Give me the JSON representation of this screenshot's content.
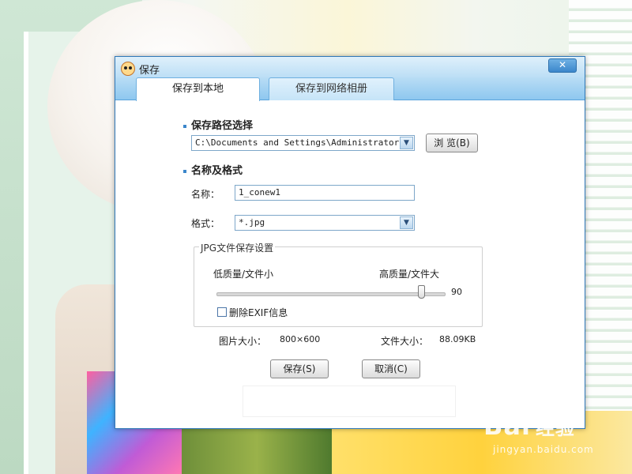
{
  "dialog": {
    "title": "保存",
    "close_label": "✕",
    "tabs": [
      {
        "label": "保存到本地",
        "active": true
      },
      {
        "label": "保存到网络相册",
        "active": false
      }
    ],
    "path_section": {
      "title": "保存路径选择",
      "path_value": "C:\\Documents and Settings\\Administrator\\…",
      "browse_label": "浏 览(B)"
    },
    "name_section": {
      "title": "名称及格式",
      "name_label": "名称：",
      "name_value": "1_conew1",
      "format_label": "格式：",
      "format_value": "*.jpg"
    },
    "jpg_settings": {
      "legend": "JPG文件保存设置",
      "low_label": "低质量/文件小",
      "high_label": "高质量/文件大",
      "quality_value": "90",
      "quality_fraction": 0.9,
      "exif_label": "删除EXIF信息",
      "exif_checked": false
    },
    "info": {
      "image_size_label": "图片大小：",
      "image_size_value": "800×600",
      "file_size_label": "文件大小：",
      "file_size_value": "88.09KB"
    },
    "buttons": {
      "save_label": "保存(S)",
      "cancel_label": "取消(C)"
    }
  },
  "watermark": {
    "logo_text": "Bai",
    "logo_cn": "经验",
    "url": "jingyan.baidu.com"
  },
  "colors": {
    "accent": "#3b86cb",
    "titlebar": "#b9ddf5"
  }
}
